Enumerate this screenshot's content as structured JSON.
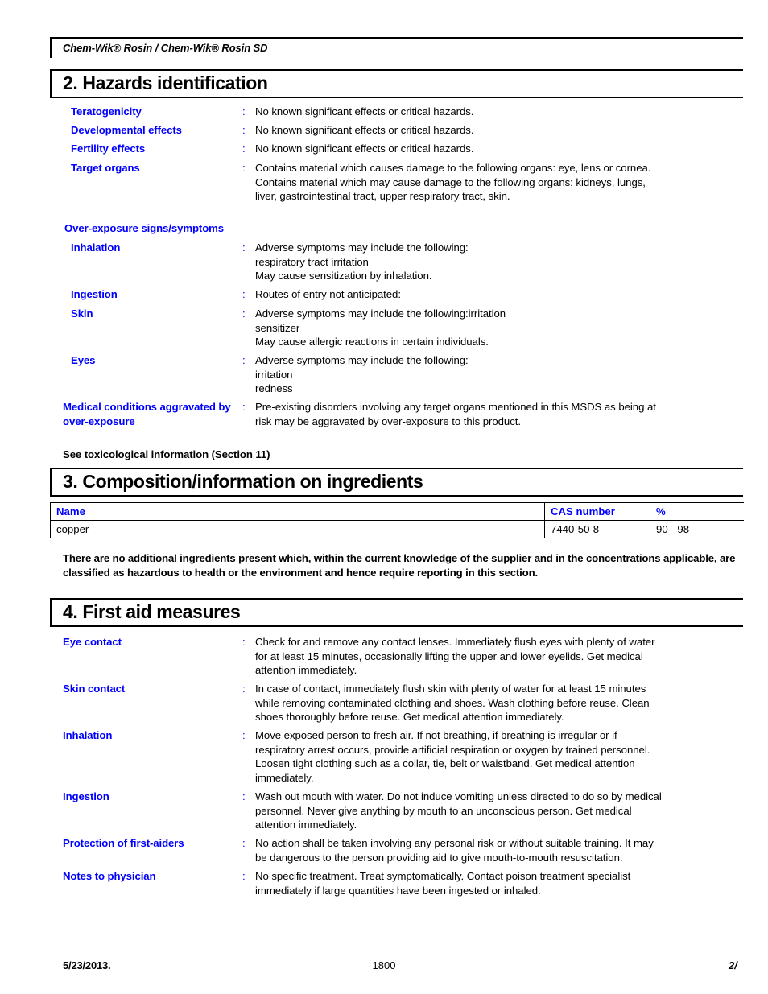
{
  "document": {
    "header_title": "Chem-Wik® Rosin / Chem-Wik® Rosin SD"
  },
  "sections": {
    "hazards": {
      "heading": "2. Hazards identification",
      "rows": [
        {
          "label": "Teratogenicity",
          "colon": ":",
          "value": "No known significant effects or critical hazards."
        },
        {
          "label": "Developmental effects",
          "colon": ":",
          "value": "No known significant effects or critical hazards."
        },
        {
          "label": "Fertility effects",
          "colon": ":",
          "value": "No known significant effects or critical hazards."
        },
        {
          "label": "Target organs",
          "colon": ":",
          "value": "Contains material which causes damage to the following organs: eye, lens or cornea.\nContains material which may cause damage to the following organs: kidneys, lungs,\nliver, gastrointestinal tract, upper respiratory tract, skin."
        }
      ],
      "subheading": "Over-exposure signs/symptoms",
      "exposure_rows": [
        {
          "label": "Inhalation",
          "colon": ":",
          "value": "Adverse symptoms may include the following:\nrespiratory tract irritation\nMay cause sensitization by inhalation."
        },
        {
          "label": "Ingestion",
          "colon": ":",
          "value": "Routes of entry not anticipated:"
        },
        {
          "label": "Skin",
          "colon": ":",
          "value": "Adverse symptoms may include the following:irritation\nsensitizer\nMay cause allergic reactions in certain individuals."
        },
        {
          "label": "Eyes",
          "colon": ":",
          "value": "Adverse symptoms may include the following:\nirritation\nredness"
        },
        {
          "label": "Medical conditions aggravated by over-exposure",
          "colon": ":",
          "value": "Pre-existing disorders involving any target organs mentioned in this MSDS as being at\nrisk may be aggravated by over-exposure to this product."
        }
      ],
      "footnote": "See toxicological information (Section 11)"
    },
    "composition": {
      "heading": "3. Composition/information on ingredients",
      "table": {
        "columns": [
          "Name",
          "CAS number",
          "%"
        ],
        "rows": [
          [
            "copper",
            "7440-50-8",
            "90 - 98"
          ]
        ]
      },
      "note": "There are no additional ingredients present which, within the current knowledge of the supplier and in the concentrations applicable, are classified as hazardous to health or the environment and hence require reporting in this section."
    },
    "first_aid": {
      "heading": "4. First aid measures",
      "rows": [
        {
          "label": "Eye contact",
          "colon": ":",
          "value": "Check for and remove any contact lenses.  Immediately flush eyes with plenty of water\nfor at least 15 minutes, occasionally lifting the upper and lower eyelids.  Get medical\nattention immediately."
        },
        {
          "label": "Skin contact",
          "colon": ":",
          "value": "In case of contact, immediately flush skin with plenty of water for at least 15 minutes\nwhile removing contaminated clothing and shoes.  Wash clothing before reuse.  Clean\nshoes thoroughly before reuse.  Get medical attention immediately."
        },
        {
          "label": "Inhalation",
          "colon": ":",
          "value": "Move exposed person to fresh air.  If not breathing, if breathing is irregular or if\nrespiratory arrest occurs, provide artificial respiration or oxygen by trained personnel.\nLoosen tight clothing such as a collar, tie, belt or waistband.  Get medical attention\nimmediately."
        },
        {
          "label": "Ingestion",
          "colon": ":",
          "value": "Wash out mouth with water.  Do not induce vomiting unless directed to do so by medical\npersonnel.  Never give anything by mouth to an unconscious person.  Get medical\nattention immediately."
        },
        {
          "label": "Protection of first-aiders",
          "colon": ":",
          "value": "No action shall be taken involving any personal risk or without suitable training.  It may\nbe dangerous to the person providing aid to give mouth-to-mouth resuscitation."
        },
        {
          "label": "Notes to physician",
          "colon": ":",
          "value": "No specific treatment.  Treat symptomatically.  Contact poison treatment specialist\nimmediately if large quantities have been ingested or inhaled."
        }
      ]
    }
  },
  "footer": {
    "date": "5/23/2013.",
    "center": "1800",
    "page": "2/"
  },
  "colors": {
    "label_blue": "#0000FF",
    "text_black": "#000000",
    "rule_black": "#000000"
  }
}
